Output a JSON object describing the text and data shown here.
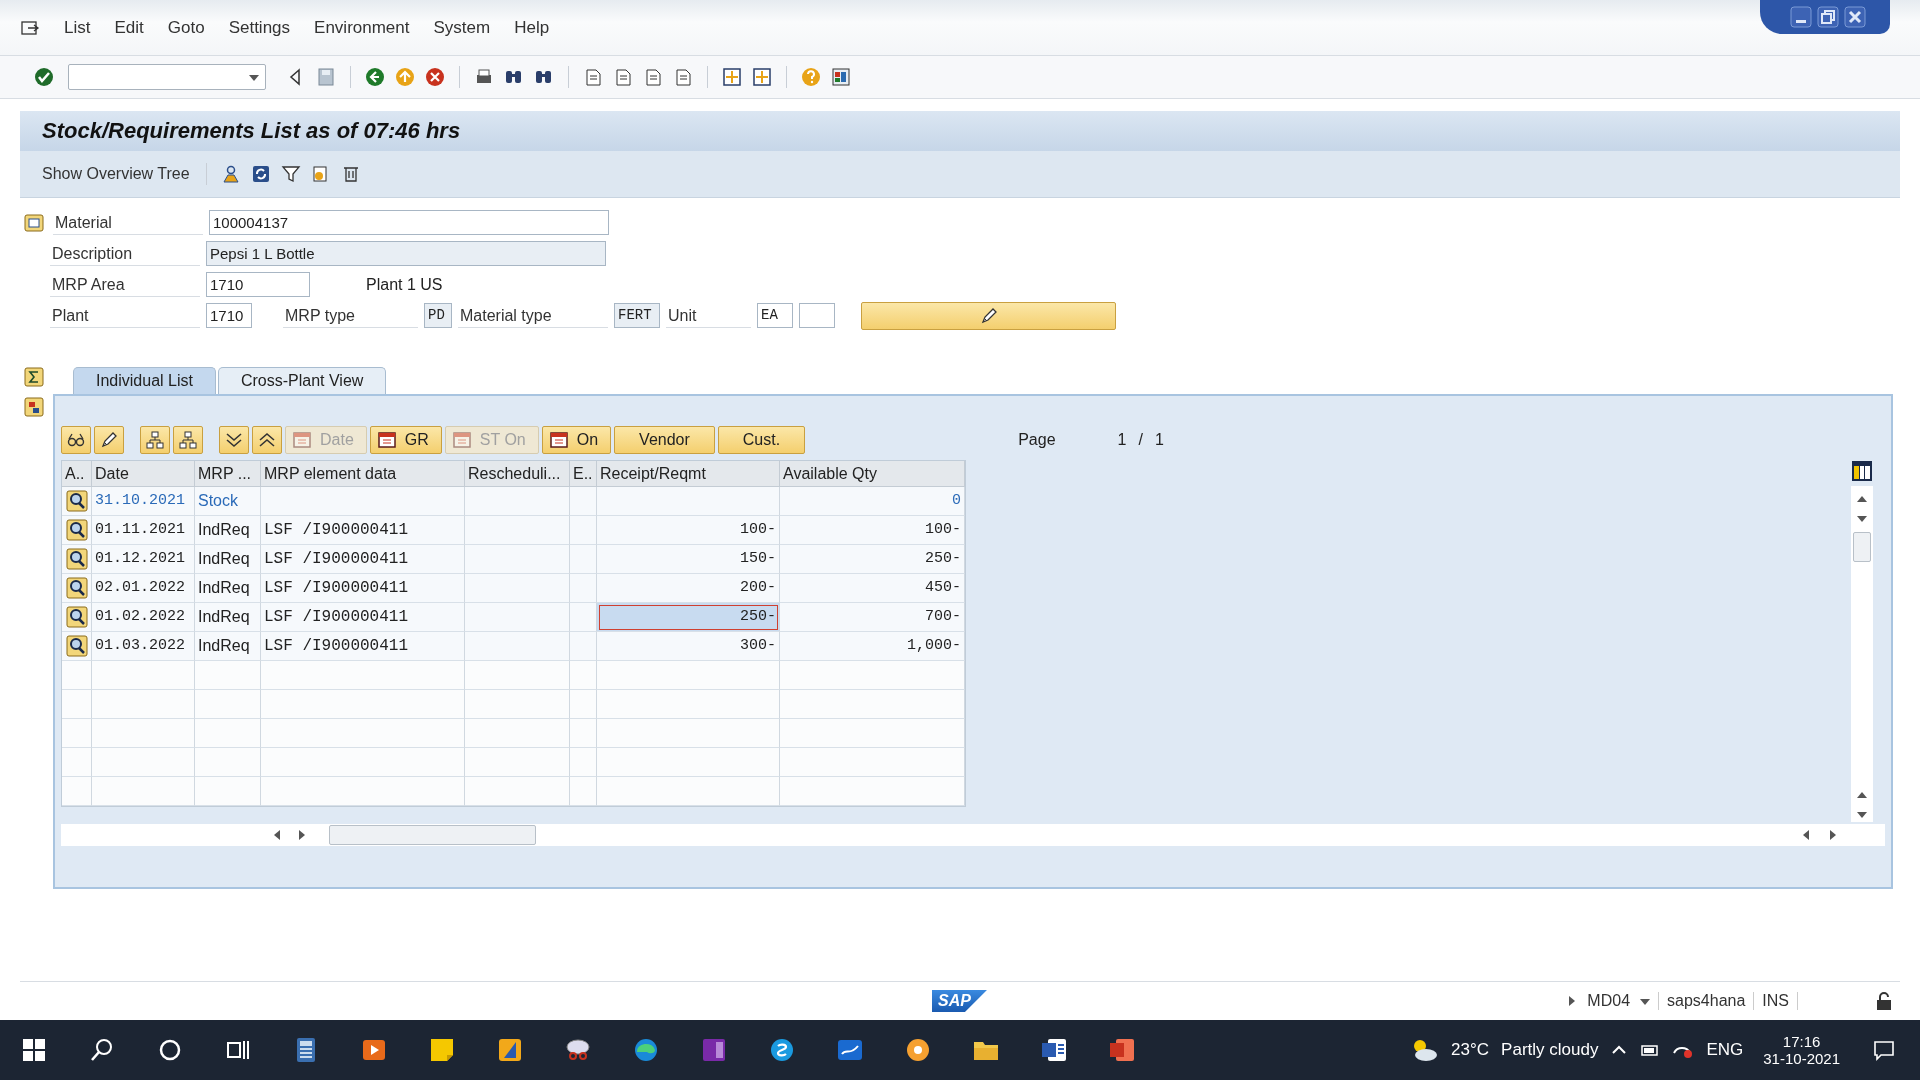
{
  "menu": [
    "List",
    "Edit",
    "Goto",
    "Settings",
    "Environment",
    "System",
    "Help"
  ],
  "screen_title": "Stock/Requirements List as of 07:46 hrs",
  "app_toolbar": {
    "button": "Show Overview Tree"
  },
  "header": {
    "material": {
      "label": "Material",
      "value": "100004137"
    },
    "description": {
      "label": "Description",
      "value": "Pepsi 1 L Bottle"
    },
    "mrp_area": {
      "label": "MRP Area",
      "value": "1710",
      "text": "Plant 1 US"
    },
    "plant": {
      "label": "Plant",
      "value": "1710"
    },
    "mrp_type": {
      "label": "MRP type",
      "value": "PD"
    },
    "material_type": {
      "label": "Material type",
      "value": "FERT"
    },
    "unit": {
      "label": "Unit",
      "value": "EA"
    }
  },
  "tabs": [
    {
      "label": "Individual List",
      "selected": true
    },
    {
      "label": "Cross-Plant View",
      "selected": false
    }
  ],
  "table_buttons": [
    {
      "label": "Date",
      "disabled": true,
      "kind": "with_icon"
    },
    {
      "label": "GR",
      "disabled": false,
      "kind": "with_icon"
    },
    {
      "label": "ST On",
      "disabled": true,
      "kind": "with_icon"
    },
    {
      "label": "On",
      "disabled": false,
      "kind": "with_icon"
    },
    {
      "label": "Vendor",
      "disabled": false,
      "kind": "plain"
    },
    {
      "label": "Cust.",
      "disabled": false,
      "kind": "plain"
    }
  ],
  "pager": {
    "label": "Page",
    "current": "1",
    "separator": "/",
    "total": "1"
  },
  "table": {
    "columns": [
      "A..",
      "Date",
      "MRP ...",
      "MRP element data",
      "Rescheduli...",
      "E..",
      "Receipt/Reqmt",
      "Available Qty"
    ],
    "rows": [
      {
        "kind": "stock",
        "date": "31.10.2021",
        "element": "Stock",
        "data": "",
        "receipt": "",
        "available": "0",
        "selected": false
      },
      {
        "kind": "requirement",
        "date": "01.11.2021",
        "element": "IndReq",
        "data": "LSF /I900000411",
        "receipt": "100-",
        "available": "100-",
        "selected": false
      },
      {
        "kind": "requirement",
        "date": "01.12.2021",
        "element": "IndReq",
        "data": "LSF /I900000411",
        "receipt": "150-",
        "available": "250-",
        "selected": false
      },
      {
        "kind": "requirement",
        "date": "02.01.2022",
        "element": "IndReq",
        "data": "LSF /I900000411",
        "receipt": "200-",
        "available": "450-",
        "selected": false
      },
      {
        "kind": "requirement",
        "date": "01.02.2022",
        "element": "IndReq",
        "data": "LSF /I900000411",
        "receipt": "250-",
        "available": "700-",
        "selected": true
      },
      {
        "kind": "requirement",
        "date": "01.03.2022",
        "element": "IndReq",
        "data": "LSF /I900000411",
        "receipt": "300-",
        "available": "1,000-",
        "selected": false
      }
    ]
  },
  "status_bar": {
    "logo": "SAP",
    "transaction": "MD04",
    "system": "saps4hana",
    "mode": "INS"
  },
  "taskbar": {
    "temperature": "23°C",
    "weather": "Partly cloudy",
    "language": "ENG",
    "time": "17:16",
    "date": "31-10-2021"
  }
}
